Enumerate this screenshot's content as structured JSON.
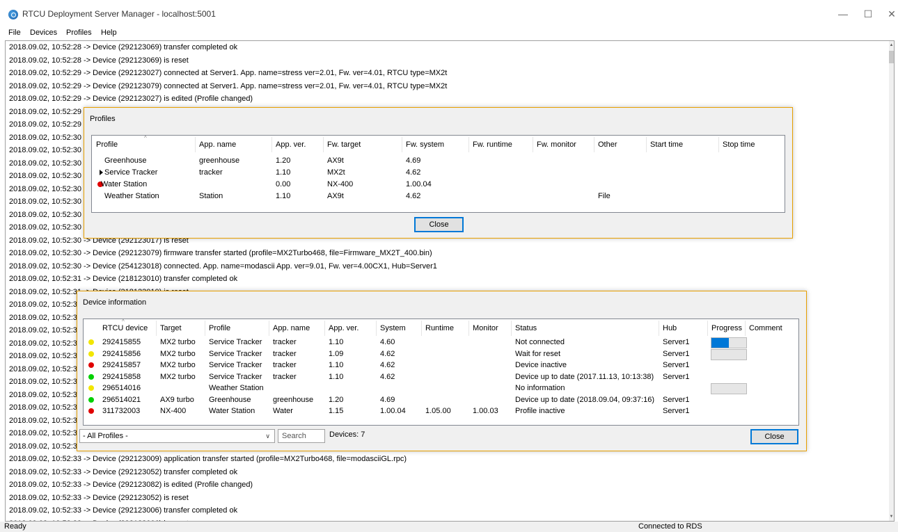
{
  "window": {
    "title": "RTCU Deployment Server Manager - localhost:5001",
    "minimize": "—",
    "maximize": "☐",
    "close": "✕"
  },
  "menu": [
    "File",
    "Devices",
    "Profiles",
    "Help"
  ],
  "log_lines": [
    "2018.09.02, 10:52:28 -> Device (292123069) transfer completed ok",
    "2018.09.02, 10:52:28 -> Device (292123069) is reset",
    "2018.09.02, 10:52:29 -> Device (292123027) connected at Server1. App. name=stress ver=2.01, Fw. ver=4.01, RTCU type=MX2t",
    "2018.09.02, 10:52:29 -> Device (292123079) connected at Server1. App. name=stress ver=2.01, Fw. ver=4.01, RTCU type=MX2t",
    "2018.09.02, 10:52:29 -> Device (292123027) is edited (Profile changed)",
    "2018.09.02, 10:52:29 -",
    "2018.09.02, 10:52:29 -",
    "2018.09.02, 10:52:30 -",
    "2018.09.02, 10:52:30 -",
    "2018.09.02, 10:52:30 -",
    "2018.09.02, 10:52:30 -",
    "2018.09.02, 10:52:30 -",
    "2018.09.02, 10:52:30 -",
    "2018.09.02, 10:52:30 -",
    "2018.09.02, 10:52:30 -",
    "2018.09.02, 10:52:30 -> Device (292123017) is reset",
    "2018.09.02, 10:52:30 -> Device (292123079) firmware transfer started (profile=MX2Turbo468, file=Firmware_MX2T_400.bin)",
    "2018.09.02, 10:52:30 -> Device (254123018) connected. App. name=modascii  App. ver=9.01, Fw. ver=4.00CX1, Hub=Server1",
    "2018.09.02, 10:52:31 -> Device (218123010) transfer completed ok",
    "2018.09.02, 10:52:31 -> Device (218123010) is reset",
    "2018.09.02, 10:52:3",
    "2018.09.02, 10:52:3",
    "2018.09.02, 10:52:3",
    "2018.09.02, 10:52:3",
    "2018.09.02, 10:52:3",
    "2018.09.02, 10:52:3",
    "2018.09.02, 10:52:3",
    "2018.09.02, 10:52:3",
    "2018.09.02, 10:52:3",
    "2018.09.02, 10:52:3",
    "2018.09.02, 10:52:3",
    "2018.09.02, 10:52:3",
    "2018.09.02, 10:52:33 -> Device (292123009) application transfer started (profile=MX2Turbo468, file=modasciiGL.rpc)",
    "2018.09.02, 10:52:33 -> Device (292123052) transfer completed ok",
    "2018.09.02, 10:52:33 -> Device (292123082) is edited (Profile changed)",
    "2018.09.02, 10:52:33 -> Device (292123052) is reset",
    "2018.09.02, 10:52:33 -> Device (292123006) transfer completed ok",
    "2018.09.02, 10:52:33 -> Device (292123006) is reset"
  ],
  "statusbar": {
    "left": "Ready",
    "right": "Connected to RDS"
  },
  "profiles_dialog": {
    "title": "Profiles",
    "columns": [
      "Profile",
      "App. name",
      "App. ver.",
      "Fw. target",
      "Fw. system",
      "Fw. runtime",
      "Fw. monitor",
      "Other",
      "Start time",
      "Stop time"
    ],
    "rows": [
      {
        "marker": "none",
        "cells": [
          "Greenhouse",
          "greenhouse",
          "1.20",
          "AX9t",
          "4.69",
          "",
          "",
          "",
          "",
          ""
        ]
      },
      {
        "marker": "arrow",
        "cells": [
          "Service Tracker",
          "tracker",
          "1.10",
          "MX2t",
          "4.62",
          "",
          "",
          "",
          "",
          ""
        ]
      },
      {
        "marker": "red",
        "cells": [
          "Water Station",
          "",
          "0.00",
          "NX-400",
          "1.00.04",
          "",
          "",
          "",
          "",
          ""
        ]
      },
      {
        "marker": "none",
        "cells": [
          "Weather Station",
          "Station",
          "1.10",
          "AX9t",
          "4.62",
          "",
          "",
          "File",
          "",
          ""
        ]
      }
    ],
    "close_label": "Close"
  },
  "device_dialog": {
    "title": "Device information",
    "columns": [
      "RTCU device",
      "Target",
      "Profile",
      "App. name",
      "App. ver.",
      "System",
      "Runtime",
      "Monitor",
      "Status",
      "Hub",
      "Progress",
      "Comment"
    ],
    "rows": [
      {
        "dot": "#f2e600",
        "progress": 0.5,
        "cells": [
          "292415855",
          "MX2 turbo",
          "Service Tracker",
          "tracker",
          "1.10",
          "4.60",
          "",
          "",
          "Not connected",
          "Server1",
          "",
          ""
        ]
      },
      {
        "dot": "#f2e600",
        "progress": 0,
        "cells": [
          "292415856",
          "MX2 turbo",
          "Service Tracker",
          "tracker",
          "1.09",
          "4.62",
          "",
          "",
          "Wait for reset",
          "Server1",
          "",
          ""
        ]
      },
      {
        "dot": "#e00000",
        "progress": null,
        "cells": [
          "292415857",
          "MX2 turbo",
          "Service Tracker",
          "tracker",
          "1.10",
          "4.62",
          "",
          "",
          "Device inactive",
          "Server1",
          "",
          ""
        ]
      },
      {
        "dot": "#00d000",
        "progress": null,
        "cells": [
          "292415858",
          "MX2 turbo",
          "Service Tracker",
          "tracker",
          "1.10",
          "4.62",
          "",
          "",
          "Device up to date (2017.11.13, 10:13:38)",
          "Server1",
          "",
          ""
        ]
      },
      {
        "dot": "#f2e600",
        "progress": 0,
        "cells": [
          "296514016",
          "",
          "Weather Station",
          "",
          "",
          "",
          "",
          "",
          "No information",
          "",
          "",
          ""
        ]
      },
      {
        "dot": "#00d000",
        "progress": null,
        "cells": [
          "296514021",
          "AX9 turbo",
          "Greenhouse",
          "greenhouse",
          "1.20",
          "4.69",
          "",
          "",
          "Device up to date (2018.09.04, 09:37:16)",
          "Server1",
          "",
          ""
        ]
      },
      {
        "dot": "#e00000",
        "progress": null,
        "cells": [
          "311732003",
          "NX-400",
          "Water Station",
          "Water",
          "1.15",
          "1.00.04",
          "1.05.00",
          "1.00.03",
          "Profile inactive",
          "Server1",
          "",
          ""
        ]
      }
    ],
    "filter_value": "- All Profiles -",
    "search_placeholder": "Search",
    "device_count": "Devices: 7",
    "close_label": "Close"
  },
  "colors": {
    "accent": "#0078d7",
    "dialog_border": "#e8a000"
  }
}
